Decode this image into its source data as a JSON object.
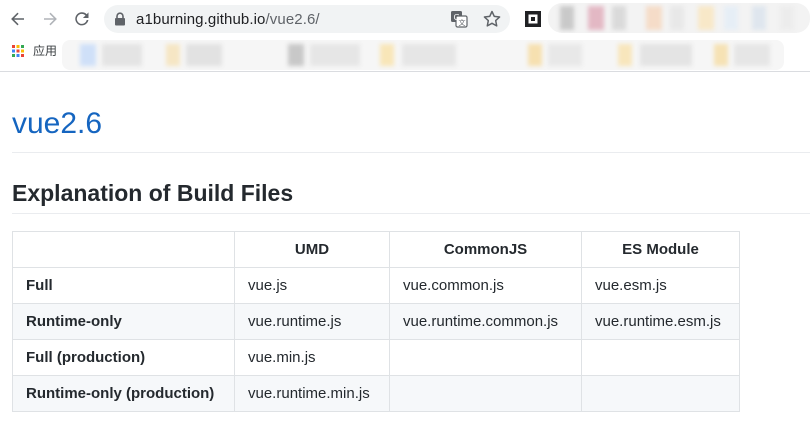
{
  "browser": {
    "url_host": "a1burning.github.io",
    "url_path": "/vue2.6/",
    "bookmarks_apps_label": "应用",
    "icons": [
      "back-arrow-icon",
      "forward-arrow-icon",
      "reload-icon",
      "lock-icon",
      "translate-icon",
      "star-icon",
      "extension-icon",
      "apps-grid-icon"
    ]
  },
  "page": {
    "title": "vue2.6",
    "section_title": "Explanation of Build Files",
    "title_color": "#1565c0"
  },
  "table": {
    "headers": [
      "",
      "UMD",
      "CommonJS",
      "ES Module"
    ],
    "rows": [
      {
        "label": "Full",
        "cells": [
          "vue.js",
          "vue.common.js",
          "vue.esm.js"
        ]
      },
      {
        "label": "Runtime-only",
        "cells": [
          "vue.runtime.js",
          "vue.runtime.common.js",
          "vue.runtime.esm.js"
        ]
      },
      {
        "label": "Full (production)",
        "cells": [
          "vue.min.js",
          "",
          ""
        ]
      },
      {
        "label": "Runtime-only (production)",
        "cells": [
          "vue.runtime.min.js",
          "",
          ""
        ]
      }
    ]
  }
}
